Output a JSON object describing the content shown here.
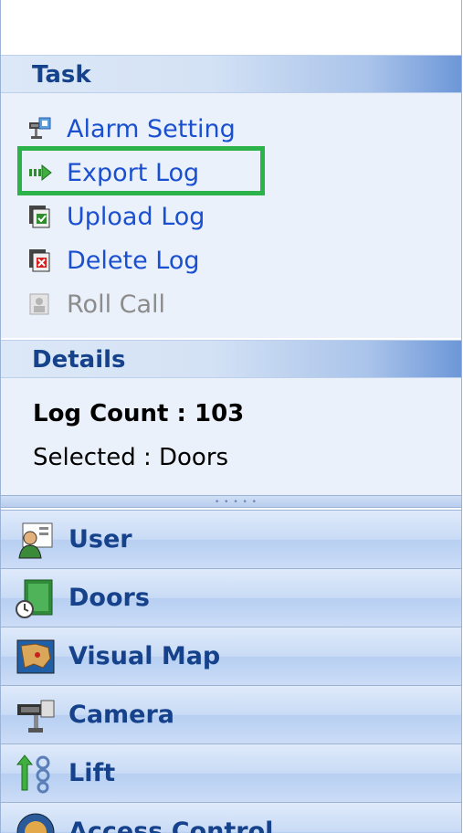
{
  "task": {
    "header": "Task",
    "items": [
      {
        "label": "Alarm Setting",
        "icon": "alarm-camera-icon",
        "enabled": true
      },
      {
        "label": "Export Log",
        "icon": "export-arrow-icon",
        "enabled": true
      },
      {
        "label": "Upload Log",
        "icon": "upload-log-icon",
        "enabled": true
      },
      {
        "label": "Delete Log",
        "icon": "delete-log-icon",
        "enabled": true
      },
      {
        "label": "Roll Call",
        "icon": "roll-call-icon",
        "enabled": false
      }
    ],
    "highlighted": "Export Log"
  },
  "details": {
    "header": "Details",
    "log_count": "Log Count : 103",
    "selected": "Selected : Doors"
  },
  "nav": [
    {
      "label": "User",
      "icon": "user-icon"
    },
    {
      "label": "Doors",
      "icon": "door-icon"
    },
    {
      "label": "Visual Map",
      "icon": "map-icon"
    },
    {
      "label": "Camera",
      "icon": "camera-icon"
    },
    {
      "label": "Lift",
      "icon": "lift-icon"
    },
    {
      "label": "Access Control",
      "icon": "access-control-icon"
    }
  ],
  "colors": {
    "header_text": "#15428b",
    "link_text": "#1a4fd0",
    "highlight": "#2bb34a"
  }
}
